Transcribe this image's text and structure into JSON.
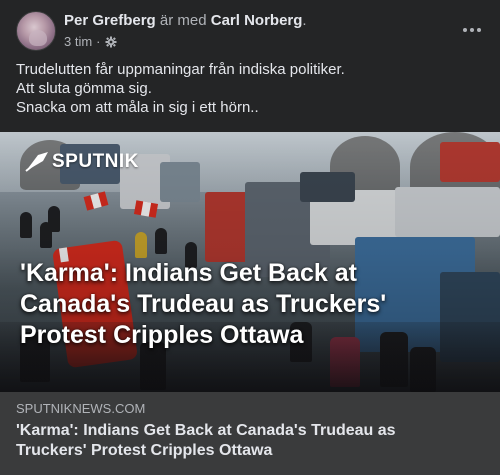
{
  "post": {
    "author": "Per Grefberg",
    "with_text": "är med",
    "tagged": "Carl Norberg",
    "tagged_suffix": ".",
    "time": "3 tim",
    "time_separator": "·",
    "privacy_icon": "gear-icon",
    "more_icon": "more-horizontal-icon",
    "message_lines": [
      "Trudelutten får uppmaningar från indiska politiker.",
      "Att sluta gömma sig.",
      "Snacka om att måla in sig i ett hörn.."
    ]
  },
  "media": {
    "logo_text": "SPUTNIK",
    "headline_lines": [
      "'Karma': Indians Get Back at",
      "Canada's Trudeau as Truckers'",
      "Protest Cripples Ottawa"
    ]
  },
  "link": {
    "domain": "SPUTNIKNEWS.COM",
    "title_lines": [
      "'Karma': Indians Get Back at Canada's Trudeau as",
      "Truckers' Protest Cripples Ottawa"
    ]
  },
  "colors": {
    "background": "#242526",
    "link_footer": "#3a3b3c",
    "primary_text": "#e4e6eb",
    "secondary_text": "#b0b3b8",
    "canada_flag_red": "#d52b1e"
  }
}
